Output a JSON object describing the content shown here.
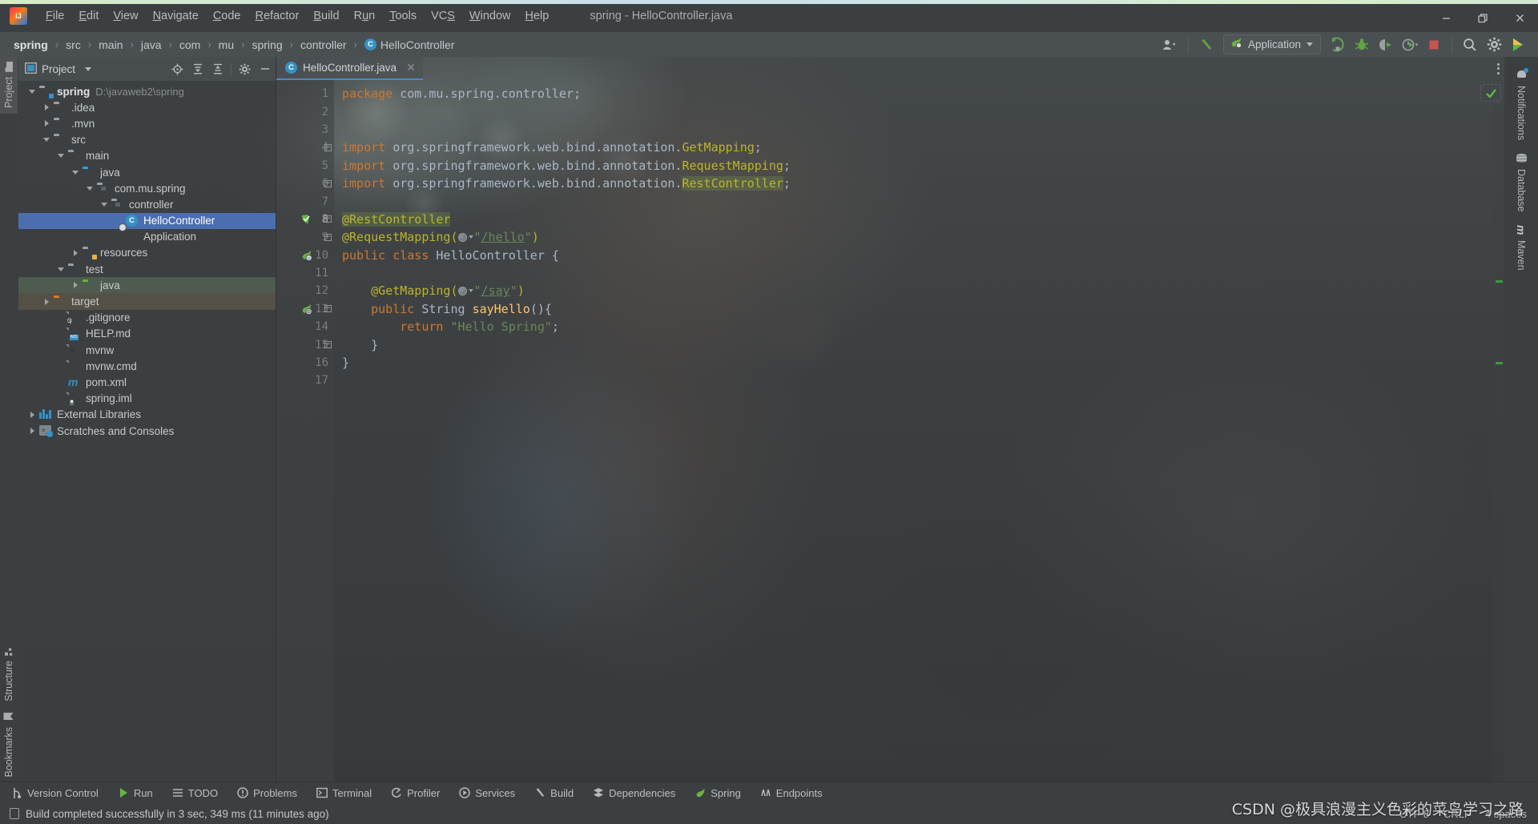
{
  "window": {
    "title": "spring - HelloController.java",
    "controls": {
      "minimize": "—",
      "maximize": "❐",
      "close": "✕"
    }
  },
  "menubar": {
    "items": [
      {
        "label": "File",
        "mnemonic": "F"
      },
      {
        "label": "Edit",
        "mnemonic": "E"
      },
      {
        "label": "View",
        "mnemonic": "V"
      },
      {
        "label": "Navigate",
        "mnemonic": "N"
      },
      {
        "label": "Code",
        "mnemonic": "C"
      },
      {
        "label": "Refactor",
        "mnemonic": "R"
      },
      {
        "label": "Build",
        "mnemonic": "B"
      },
      {
        "label": "Run",
        "mnemonic": "u"
      },
      {
        "label": "Tools",
        "mnemonic": "T"
      },
      {
        "label": "VCS",
        "mnemonic": "S"
      },
      {
        "label": "Window",
        "mnemonic": "W"
      },
      {
        "label": "Help",
        "mnemonic": "H"
      }
    ]
  },
  "navbar": {
    "breadcrumbs": [
      {
        "label": "spring",
        "bold": true
      },
      {
        "label": "src",
        "bold": false
      },
      {
        "label": "main",
        "bold": false
      },
      {
        "label": "java",
        "bold": false
      },
      {
        "label": "com",
        "bold": false
      },
      {
        "label": "mu",
        "bold": false
      },
      {
        "label": "spring",
        "bold": false
      },
      {
        "label": "controller",
        "bold": false
      },
      {
        "label": "HelloController",
        "bold": false,
        "icon": "class-icon",
        "badge": "C"
      }
    ],
    "separator": "›",
    "run_configuration": {
      "label": "Application",
      "icon": "spring-boot-icon"
    },
    "actions": [
      {
        "name": "user-account-icon",
        "label": ""
      },
      {
        "name": "build-hammer-icon",
        "label": ""
      },
      {
        "name": "run-icon",
        "label": ""
      },
      {
        "name": "debug-icon",
        "label": ""
      },
      {
        "name": "run-with-coverage-icon",
        "label": ""
      },
      {
        "name": "profiler-icon",
        "label": ""
      },
      {
        "name": "stop-icon",
        "label": ""
      },
      {
        "name": "search-everywhere-icon",
        "label": ""
      },
      {
        "name": "settings-gear-icon",
        "label": ""
      },
      {
        "name": "updates-icon",
        "label": ""
      }
    ]
  },
  "left_stripe": {
    "top": [
      {
        "label": "Project",
        "icon": "project-folder-icon",
        "active": true
      }
    ],
    "bottom": [
      {
        "label": "Structure",
        "icon": "structure-icon",
        "active": false
      },
      {
        "label": "Bookmarks",
        "icon": "bookmark-icon",
        "active": false
      }
    ]
  },
  "right_stripe": {
    "items": [
      {
        "label": "Notifications",
        "icon": "bell-icon"
      },
      {
        "label": "Database",
        "icon": "database-icon"
      },
      {
        "label": "Maven",
        "icon": "maven-icon"
      }
    ]
  },
  "project_panel": {
    "title": "Project",
    "header_actions": [
      {
        "name": "select-opened-file-icon"
      },
      {
        "name": "expand-all-icon"
      },
      {
        "name": "collapse-all-icon"
      },
      {
        "name": "panel-settings-icon"
      },
      {
        "name": "hide-panel-icon"
      }
    ],
    "tree": [
      {
        "label": "spring",
        "sub": "D:\\javaweb2\\spring",
        "indent": 0,
        "twisty": "open",
        "icon": "module-folder-icon",
        "bold": true,
        "state": "normal"
      },
      {
        "label": ".idea",
        "sub": "",
        "indent": 1,
        "twisty": "closed",
        "icon": "folder-icon",
        "bold": false,
        "state": "normal"
      },
      {
        "label": ".mvn",
        "sub": "",
        "indent": 1,
        "twisty": "closed",
        "icon": "folder-icon",
        "bold": false,
        "state": "normal"
      },
      {
        "label": "src",
        "sub": "",
        "indent": 1,
        "twisty": "open",
        "icon": "folder-icon",
        "bold": false,
        "state": "normal"
      },
      {
        "label": "main",
        "sub": "",
        "indent": 2,
        "twisty": "open",
        "icon": "folder-icon",
        "bold": false,
        "state": "normal"
      },
      {
        "label": "java",
        "sub": "",
        "indent": 3,
        "twisty": "open",
        "icon": "source-root-icon",
        "bold": false,
        "state": "normal"
      },
      {
        "label": "com.mu.spring",
        "sub": "",
        "indent": 4,
        "twisty": "open",
        "icon": "package-icon",
        "bold": false,
        "state": "normal"
      },
      {
        "label": "controller",
        "sub": "",
        "indent": 5,
        "twisty": "open",
        "icon": "package-icon",
        "bold": false,
        "state": "normal"
      },
      {
        "label": "HelloController",
        "sub": "",
        "indent": 6,
        "twisty": "none",
        "icon": "class-icon",
        "bold": false,
        "state": "selected"
      },
      {
        "label": "Application",
        "sub": "",
        "indent": 6,
        "twisty": "none",
        "icon": "spring-boot-class-icon",
        "bold": false,
        "state": "normal"
      },
      {
        "label": "resources",
        "sub": "",
        "indent": 3,
        "twisty": "closed",
        "icon": "resource-root-icon",
        "bold": false,
        "state": "normal"
      },
      {
        "label": "test",
        "sub": "",
        "indent": 2,
        "twisty": "open",
        "icon": "folder-icon",
        "bold": false,
        "state": "normal"
      },
      {
        "label": "java",
        "sub": "",
        "indent": 3,
        "twisty": "closed",
        "icon": "test-source-root-icon",
        "bold": false,
        "state": "hl-green"
      },
      {
        "label": "target",
        "sub": "",
        "indent": 1,
        "twisty": "closed",
        "icon": "excluded-folder-icon",
        "bold": false,
        "state": "hl-brown"
      },
      {
        "label": ".gitignore",
        "sub": "",
        "indent": 2,
        "twisty": "none",
        "icon": "gitignore-file-icon",
        "bold": false,
        "state": "normal"
      },
      {
        "label": "HELP.md",
        "sub": "",
        "indent": 2,
        "twisty": "none",
        "icon": "markdown-file-icon",
        "bold": false,
        "state": "normal"
      },
      {
        "label": "mvnw",
        "sub": "",
        "indent": 2,
        "twisty": "none",
        "icon": "shell-script-icon",
        "bold": false,
        "state": "normal"
      },
      {
        "label": "mvnw.cmd",
        "sub": "",
        "indent": 2,
        "twisty": "none",
        "icon": "cmd-file-icon",
        "bold": false,
        "state": "normal"
      },
      {
        "label": "pom.xml",
        "sub": "",
        "indent": 2,
        "twisty": "none",
        "icon": "maven-pom-icon",
        "bold": false,
        "state": "normal"
      },
      {
        "label": "spring.iml",
        "sub": "",
        "indent": 2,
        "twisty": "none",
        "icon": "iml-file-icon",
        "bold": false,
        "state": "normal"
      },
      {
        "label": "External Libraries",
        "sub": "",
        "indent": 0,
        "twisty": "closed",
        "icon": "libraries-icon",
        "bold": false,
        "state": "normal"
      },
      {
        "label": "Scratches and Consoles",
        "sub": "",
        "indent": 0,
        "twisty": "closed",
        "icon": "scratches-icon",
        "bold": false,
        "state": "normal"
      }
    ]
  },
  "editor": {
    "tabs": [
      {
        "label": "HelloController.java",
        "icon": "java-class-icon",
        "badge": "C",
        "active": true,
        "close": "✕"
      }
    ],
    "lines": [
      {
        "n": 1,
        "gutter_icon": "",
        "fold": "",
        "segments": [
          {
            "t": "package ",
            "c": "kw"
          },
          {
            "t": "com.mu.spring.controller;",
            "c": "cls"
          }
        ]
      },
      {
        "n": 2,
        "gutter_icon": "",
        "fold": "",
        "segments": []
      },
      {
        "n": 3,
        "gutter_icon": "",
        "fold": "",
        "segments": []
      },
      {
        "n": 4,
        "gutter_icon": "",
        "fold": "minus",
        "segments": [
          {
            "t": "import ",
            "c": "kw"
          },
          {
            "t": "org.springframework.web.bind.annotation.",
            "c": "cls"
          },
          {
            "t": "GetMapping",
            "c": "ann"
          },
          {
            "t": ";",
            "c": "cls"
          }
        ]
      },
      {
        "n": 5,
        "gutter_icon": "",
        "fold": "",
        "segments": [
          {
            "t": "import ",
            "c": "kw"
          },
          {
            "t": "org.springframework.web.bind.annotation.",
            "c": "cls"
          },
          {
            "t": "RequestMapping",
            "c": "ann"
          },
          {
            "t": ";",
            "c": "cls"
          }
        ]
      },
      {
        "n": 6,
        "gutter_icon": "",
        "fold": "minus",
        "segments": [
          {
            "t": "import ",
            "c": "kw"
          },
          {
            "t": "org.springframework.web.bind.annotation.",
            "c": "cls"
          },
          {
            "t": "RestController",
            "c": "ann hlg"
          },
          {
            "t": ";",
            "c": "cls"
          }
        ]
      },
      {
        "n": 7,
        "gutter_icon": "",
        "fold": "",
        "segments": []
      },
      {
        "n": 8,
        "gutter_icon": "inspection-ok-icon",
        "fold": "minus",
        "segments": [
          {
            "t": "@RestController",
            "c": "ann hlg"
          }
        ]
      },
      {
        "n": 9,
        "gutter_icon": "",
        "fold": "minus",
        "segments": [
          {
            "t": "@RequestMapping(",
            "c": "ann"
          },
          {
            "t": "GLOBE",
            "c": "globe"
          },
          {
            "t": "\"",
            "c": "str"
          },
          {
            "t": "/hello",
            "c": "link"
          },
          {
            "t": "\"",
            "c": "str"
          },
          {
            "t": ")",
            "c": "ann"
          }
        ]
      },
      {
        "n": 10,
        "gutter_icon": "spring-bean-icon",
        "fold": "",
        "segments": [
          {
            "t": "public class ",
            "c": "kw"
          },
          {
            "t": "HelloController ",
            "c": "cls"
          },
          {
            "t": "{",
            "c": "cls"
          }
        ]
      },
      {
        "n": 11,
        "gutter_icon": "",
        "fold": "",
        "segments": []
      },
      {
        "n": 12,
        "gutter_icon": "",
        "fold": "",
        "segments": [
          {
            "t": "    @GetMapping(",
            "c": "ann"
          },
          {
            "t": "GLOBE",
            "c": "globe"
          },
          {
            "t": "\"",
            "c": "str"
          },
          {
            "t": "/say",
            "c": "link"
          },
          {
            "t": "\"",
            "c": "str"
          },
          {
            "t": ")",
            "c": "ann"
          }
        ]
      },
      {
        "n": 13,
        "gutter_icon": "spring-mapping-icon",
        "fold": "minus",
        "segments": [
          {
            "t": "    public ",
            "c": "kw"
          },
          {
            "t": "String ",
            "c": "cls"
          },
          {
            "t": "sayHello",
            "c": "mth"
          },
          {
            "t": "(){",
            "c": "cls"
          }
        ]
      },
      {
        "n": 14,
        "gutter_icon": "",
        "fold": "",
        "segments": [
          {
            "t": "        return ",
            "c": "kw"
          },
          {
            "t": "\"Hello Spring\"",
            "c": "str"
          },
          {
            "t": ";",
            "c": "cls"
          }
        ]
      },
      {
        "n": 15,
        "gutter_icon": "",
        "fold": "minus",
        "segments": [
          {
            "t": "    }",
            "c": "cls"
          }
        ]
      },
      {
        "n": 16,
        "gutter_icon": "",
        "fold": "",
        "segments": [
          {
            "t": "}",
            "c": "cls"
          }
        ]
      },
      {
        "n": 17,
        "gutter_icon": "",
        "fold": "",
        "segments": []
      }
    ],
    "inspection_status": "ok",
    "markers": [
      {
        "top_pct": 26
      },
      {
        "top_pct": 38
      }
    ]
  },
  "tool_window_bar": {
    "items": [
      {
        "label": "Version Control",
        "icon": "vcs-branch-icon"
      },
      {
        "label": "Run",
        "icon": "run-triangle-icon"
      },
      {
        "label": "TODO",
        "icon": "todo-list-icon"
      },
      {
        "label": "Problems",
        "icon": "problems-warning-icon"
      },
      {
        "label": "Terminal",
        "icon": "terminal-icon"
      },
      {
        "label": "Profiler",
        "icon": "profiler-icon"
      },
      {
        "label": "Services",
        "icon": "services-icon"
      },
      {
        "label": "Build",
        "icon": "build-hammer-icon"
      },
      {
        "label": "Dependencies",
        "icon": "dependencies-icon"
      },
      {
        "label": "Spring",
        "icon": "spring-leaf-icon"
      },
      {
        "label": "Endpoints",
        "icon": "endpoints-icon"
      }
    ]
  },
  "statusbar": {
    "message": "Build completed successfully in 3 sec, 349 ms (11 minutes ago)",
    "right": [
      "UTF-8",
      "CRLF",
      "4 spaces"
    ]
  },
  "watermark": {
    "text": "CSDN @极具浪漫主义色彩的菜鸟学习之路"
  },
  "colors": {
    "accent_blue": "#3592c4",
    "selection_blue": "#4b6eaf",
    "spring_green": "#62b543",
    "keyword_orange": "#cc7832",
    "string_green": "#6a8759",
    "annotation_yellow": "#bbb529",
    "method_yellow": "#ffc66d",
    "panel_bg": "#3c3f41",
    "navbar_bg": "#4a4f52"
  }
}
